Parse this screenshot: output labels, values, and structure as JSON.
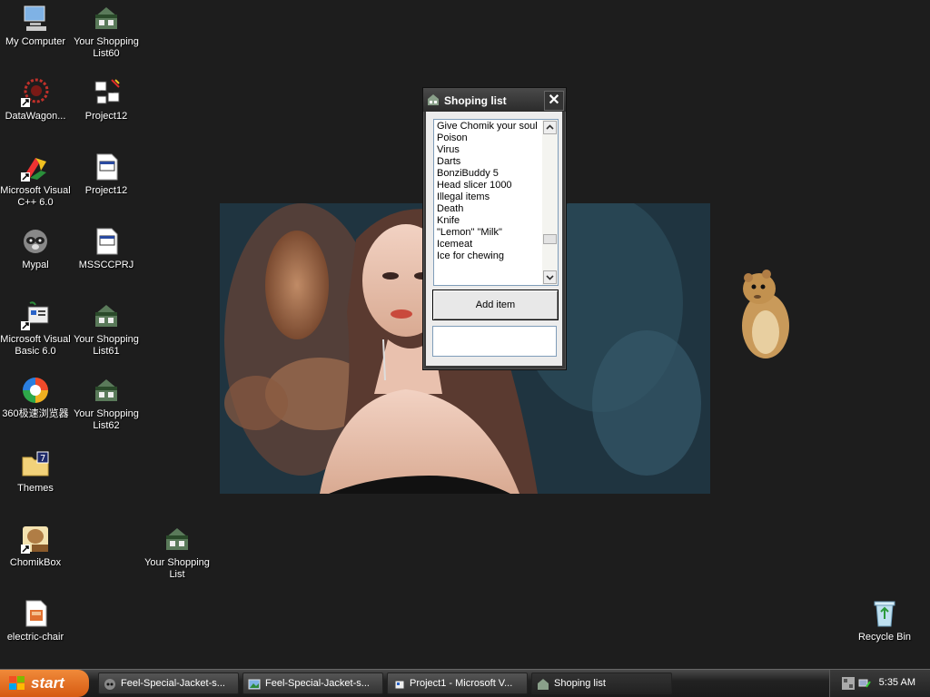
{
  "desktop": {
    "icons": [
      {
        "label": "My Computer"
      },
      {
        "label": "Your Shopping List60"
      },
      {
        "label": "DataWagon..."
      },
      {
        "label": "Project12"
      },
      {
        "label": "Microsoft Visual C++ 6.0"
      },
      {
        "label": "Project12"
      },
      {
        "label": "Mypal"
      },
      {
        "label": "MSSCCPRJ"
      },
      {
        "label": "Microsoft Visual Basic 6.0"
      },
      {
        "label": "Your Shopping List61"
      },
      {
        "label": "360极速浏览器"
      },
      {
        "label": "Your Shopping List62"
      },
      {
        "label": "Themes"
      },
      {
        "label": "ChomikBox"
      },
      {
        "label": "Your Shopping List"
      },
      {
        "label": "electric-chair"
      },
      {
        "label": "Recycle Bin"
      }
    ]
  },
  "window": {
    "title": "Shoping list",
    "close_glyph": "✕",
    "list_items": [
      "Give Chomik your soul",
      "Poison",
      "Virus",
      "Darts",
      "BonziBuddy 5",
      "Head slicer 1000",
      "Illegal items",
      "Death",
      "Knife",
      "\"Lemon\" \"Milk\"",
      "Icemeat",
      "Ice for chewing"
    ],
    "add_button_label": "Add item",
    "input_value": ""
  },
  "taskbar": {
    "start_label": "start",
    "tasks": [
      {
        "label": "Feel-Special-Jacket-s..."
      },
      {
        "label": "Feel-Special-Jacket-s..."
      },
      {
        "label": "Project1 - Microsoft V..."
      },
      {
        "label": "Shoping list"
      }
    ],
    "clock": "5:35 AM"
  },
  "colors": {
    "desktop_bg": "#1d1d1d",
    "start_orange": "#d65a12"
  }
}
